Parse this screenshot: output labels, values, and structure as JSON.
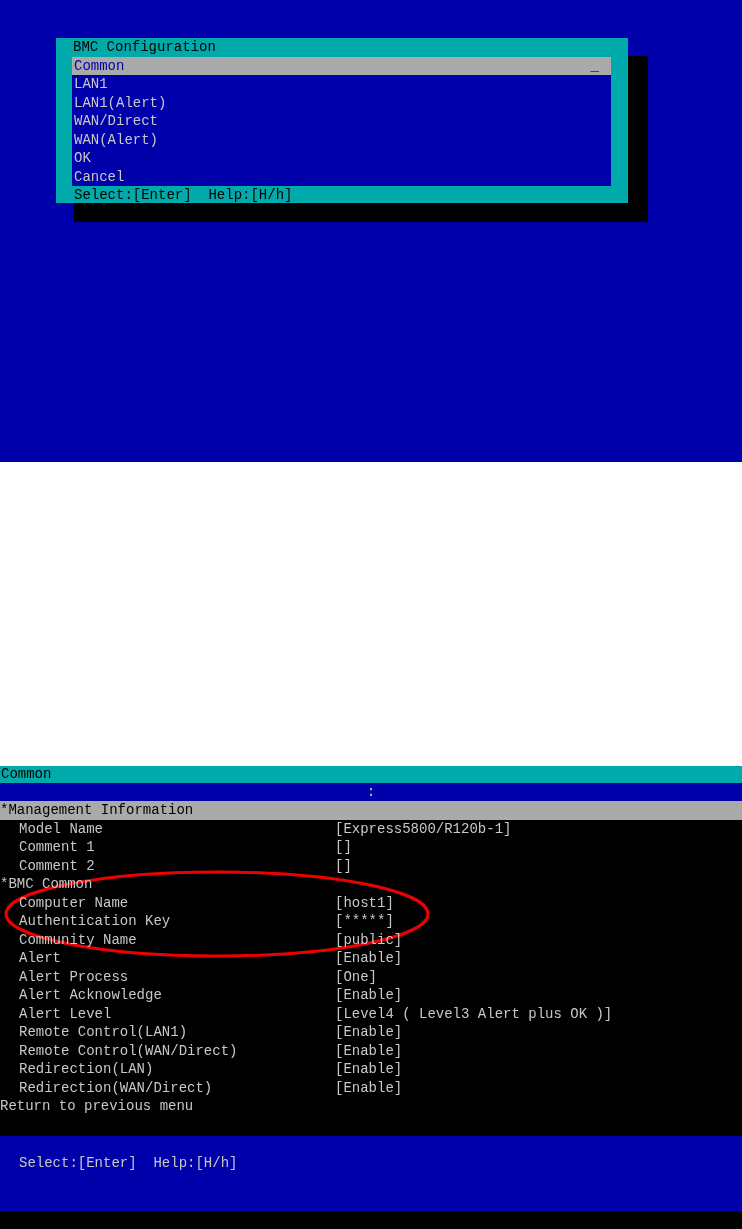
{
  "menu_screen": {
    "title": "BMC Configuration",
    "cursor": "_",
    "items": [
      {
        "label": "Common",
        "selected": true
      },
      {
        "label": "LAN1",
        "selected": false
      },
      {
        "label": "LAN1(Alert)",
        "selected": false
      },
      {
        "label": "WAN/Direct",
        "selected": false
      },
      {
        "label": "WAN(Alert)",
        "selected": false
      },
      {
        "label": "OK",
        "selected": false
      },
      {
        "label": "Cancel",
        "selected": false
      }
    ],
    "footer": "Select:[Enter]  Help:[H/h]"
  },
  "common_screen": {
    "title": "Common",
    "separator": ":",
    "rows": [
      {
        "kind": "header",
        "label": "*Management Information",
        "selected": true
      },
      {
        "kind": "setting",
        "label": "Model Name",
        "value": "[Express5800/R120b-1]",
        "selected": false
      },
      {
        "kind": "setting",
        "label": "Comment 1",
        "value": "[]",
        "selected": false
      },
      {
        "kind": "setting",
        "label": "Comment 2",
        "value": "[]",
        "selected": false
      },
      {
        "kind": "header",
        "label": "*BMC Common",
        "selected": false
      },
      {
        "kind": "setting",
        "label": "Computer Name",
        "value": "[host1]",
        "selected": false
      },
      {
        "kind": "setting",
        "label": "Authentication Key",
        "value": "[*****]",
        "selected": false
      },
      {
        "kind": "setting",
        "label": "Community Name",
        "value": "[public]",
        "selected": false
      },
      {
        "kind": "setting",
        "label": "Alert",
        "value": "[Enable]",
        "selected": false
      },
      {
        "kind": "setting",
        "label": "Alert Process",
        "value": "[One]",
        "selected": false
      },
      {
        "kind": "setting",
        "label": "Alert Acknowledge",
        "value": "[Enable]",
        "selected": false
      },
      {
        "kind": "setting",
        "label": "Alert Level",
        "value": "[Level4 ( Level3 Alert plus OK )]",
        "selected": false
      },
      {
        "kind": "setting",
        "label": "Remote Control(LAN1)",
        "value": "[Enable]",
        "selected": false
      },
      {
        "kind": "setting",
        "label": "Remote Control(WAN/Direct)",
        "value": "[Enable]",
        "selected": false
      },
      {
        "kind": "setting",
        "label": "Redirection(LAN)",
        "value": "[Enable]",
        "selected": false
      },
      {
        "kind": "setting",
        "label": "Redirection(WAN/Direct)",
        "value": "[Enable]",
        "selected": false
      },
      {
        "kind": "action",
        "label": "Return to previous menu",
        "selected": false
      }
    ],
    "footer": "Select:[Enter]  Help:[H/h]"
  }
}
